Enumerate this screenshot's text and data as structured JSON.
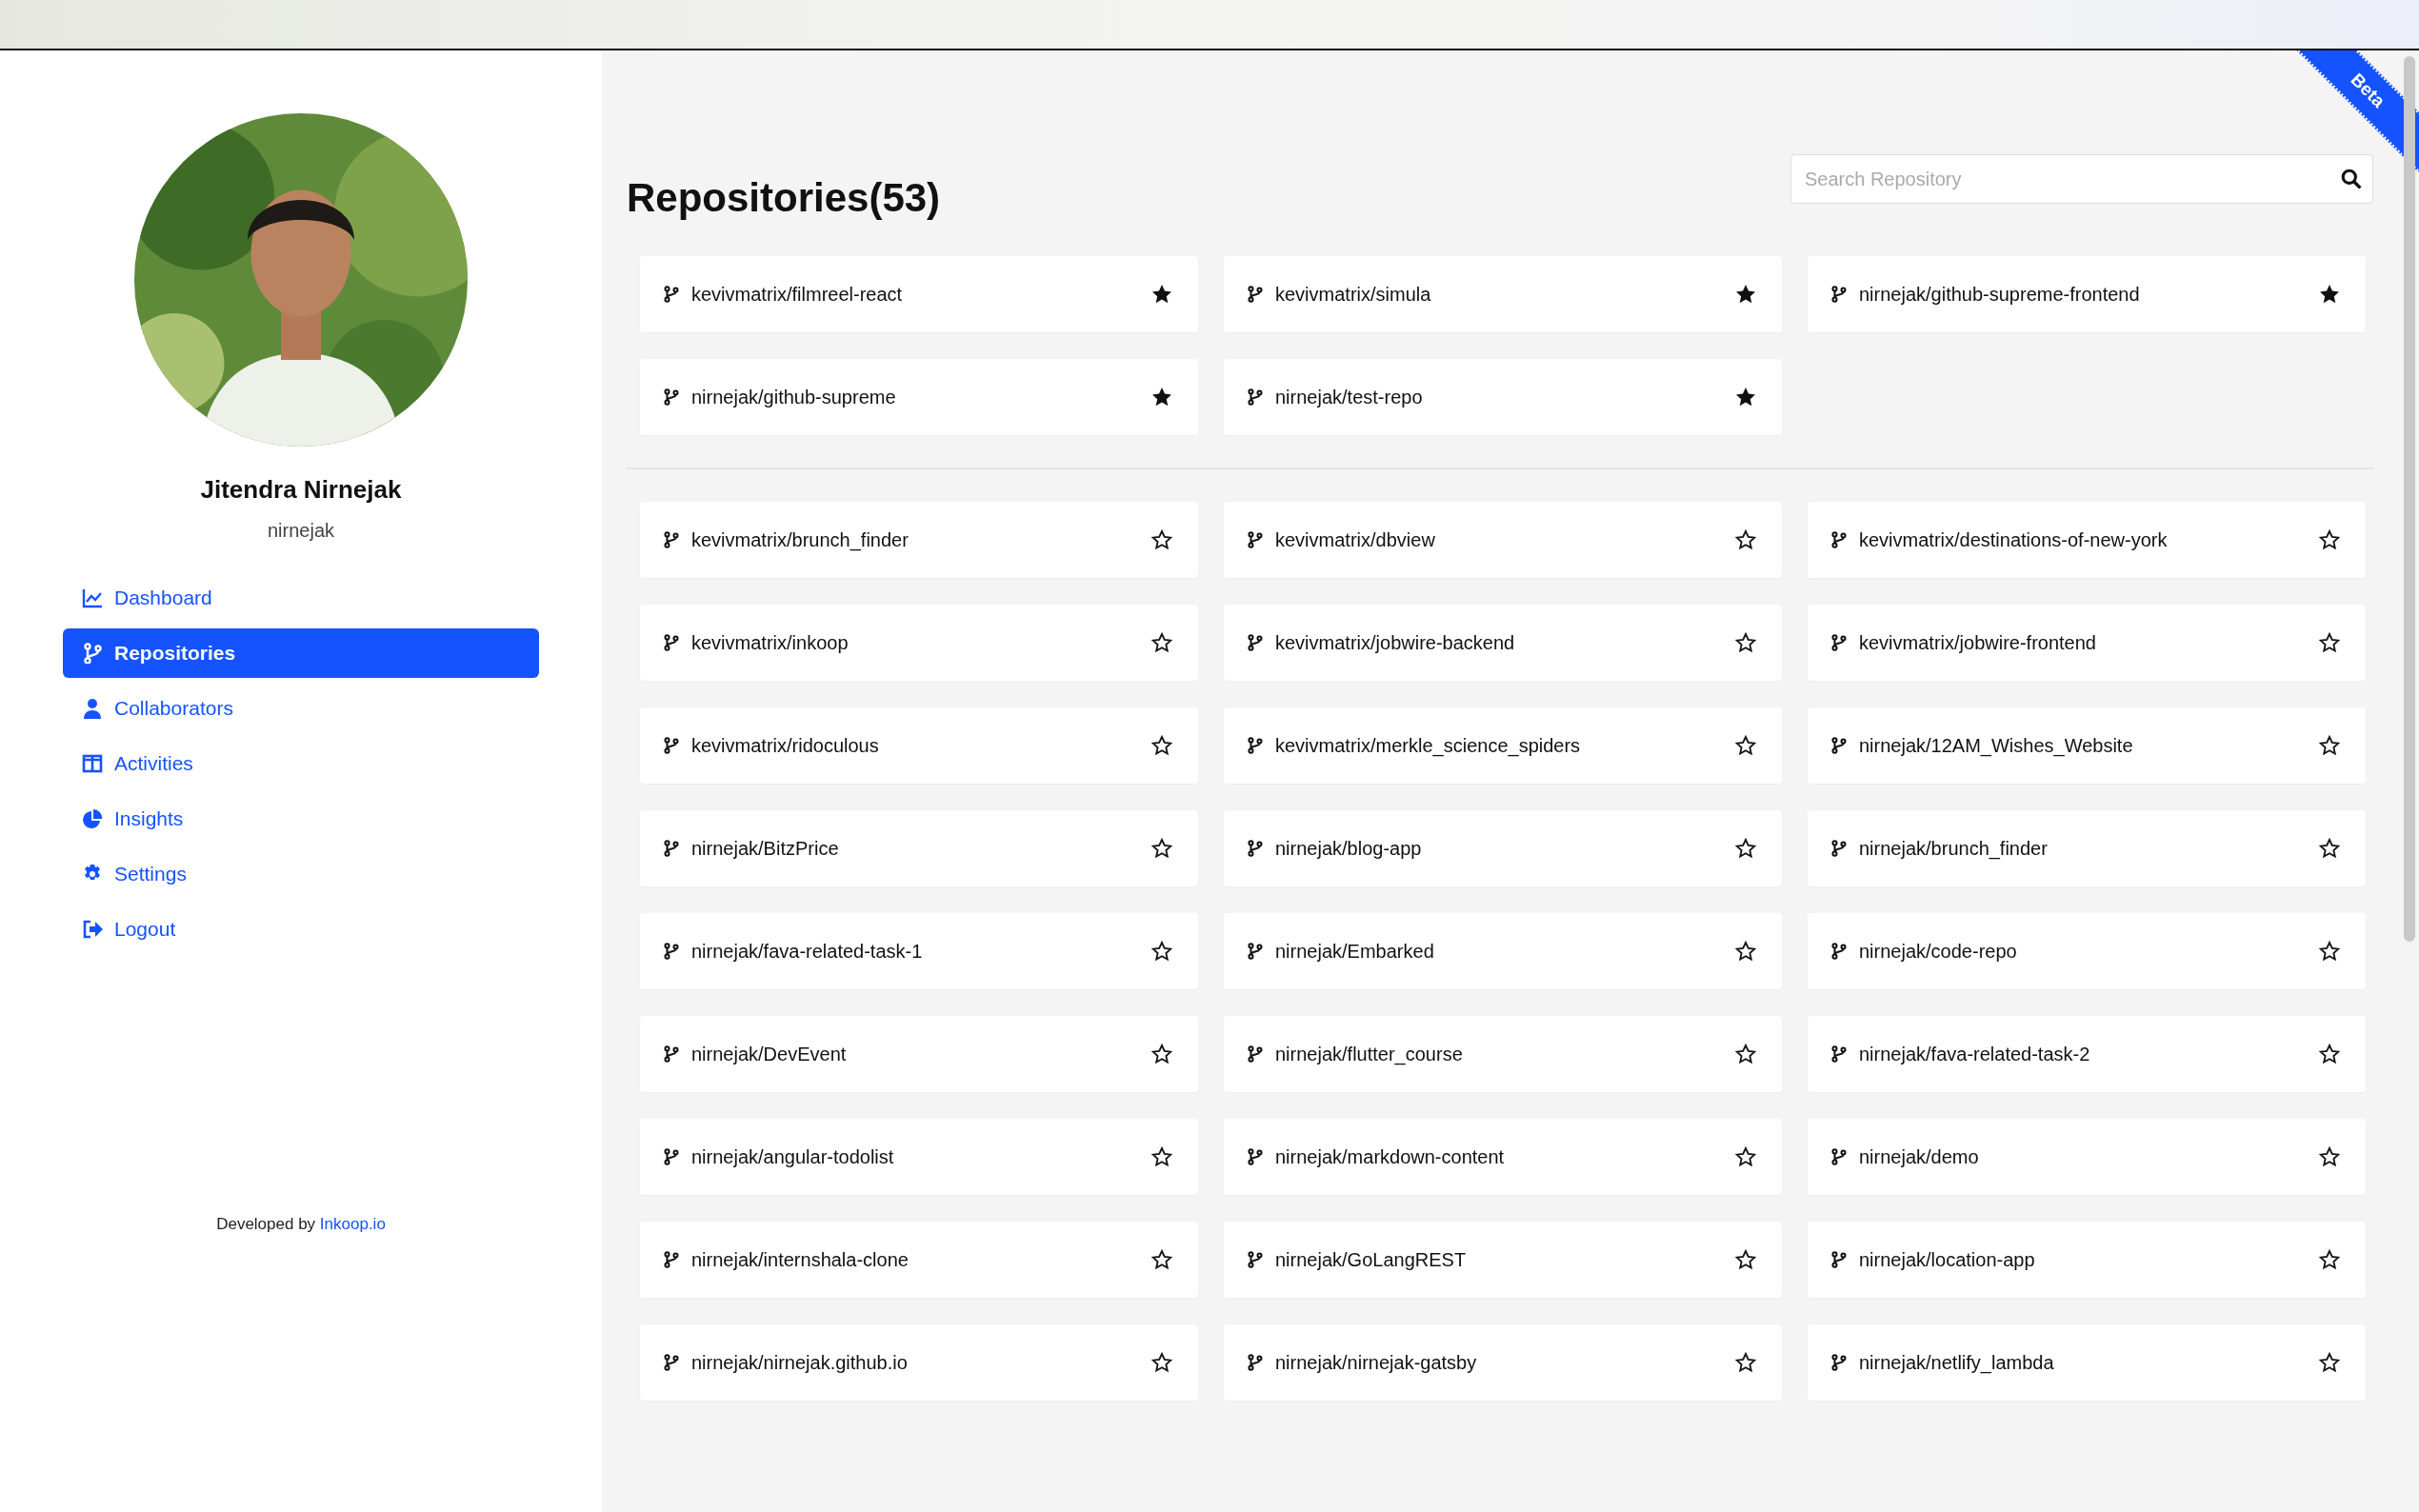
{
  "sidebar": {
    "profile": {
      "name": "Jitendra Nirnejak",
      "username": "nirnejak"
    },
    "nav": [
      {
        "label": "Dashboard",
        "selected": false
      },
      {
        "label": "Repositories",
        "selected": true
      },
      {
        "label": "Collaborators",
        "selected": false
      },
      {
        "label": "Activities",
        "selected": false
      },
      {
        "label": "Insights",
        "selected": false
      },
      {
        "label": "Settings",
        "selected": false
      },
      {
        "label": "Logout",
        "selected": false
      }
    ],
    "footer": {
      "text": "Developed by",
      "link": "Inkoop.io"
    }
  },
  "main": {
    "title": "Repositories(53)",
    "ribbon": "Beta",
    "search": {
      "placeholder": "Search Repository"
    },
    "starred_repos": [
      {
        "name": "kevivmatrix/filmreel-react",
        "starred": true
      },
      {
        "name": "kevivmatrix/simula",
        "starred": true
      },
      {
        "name": "nirnejak/github-supreme-frontend",
        "starred": true
      },
      {
        "name": "nirnejak/github-supreme",
        "starred": true
      },
      {
        "name": "nirnejak/test-repo",
        "starred": true
      }
    ],
    "repos": [
      {
        "name": "kevivmatrix/brunch_finder",
        "starred": false
      },
      {
        "name": "kevivmatrix/dbview",
        "starred": false
      },
      {
        "name": "kevivmatrix/destinations-of-new-york",
        "starred": false
      },
      {
        "name": "kevivmatrix/inkoop",
        "starred": false
      },
      {
        "name": "kevivmatrix/jobwire-backend",
        "starred": false
      },
      {
        "name": "kevivmatrix/jobwire-frontend",
        "starred": false
      },
      {
        "name": "kevivmatrix/ridoculous",
        "starred": false
      },
      {
        "name": "kevivmatrix/merkle_science_spiders",
        "starred": false
      },
      {
        "name": "nirnejak/12AM_Wishes_Website",
        "starred": false
      },
      {
        "name": "nirnejak/BitzPrice",
        "starred": false
      },
      {
        "name": "nirnejak/blog-app",
        "starred": false
      },
      {
        "name": "nirnejak/brunch_finder",
        "starred": false
      },
      {
        "name": "nirnejak/fava-related-task-1",
        "starred": false
      },
      {
        "name": "nirnejak/Embarked",
        "starred": false
      },
      {
        "name": "nirnejak/code-repo",
        "starred": false
      },
      {
        "name": "nirnejak/DevEvent",
        "starred": false
      },
      {
        "name": "nirnejak/flutter_course",
        "starred": false
      },
      {
        "name": "nirnejak/fava-related-task-2",
        "starred": false
      },
      {
        "name": "nirnejak/angular-todolist",
        "starred": false
      },
      {
        "name": "nirnejak/markdown-content",
        "starred": false
      },
      {
        "name": "nirnejak/demo",
        "starred": false
      },
      {
        "name": "nirnejak/internshala-clone",
        "starred": false
      },
      {
        "name": "nirnejak/GoLangREST",
        "starred": false
      },
      {
        "name": "nirnejak/location-app",
        "starred": false
      },
      {
        "name": "nirnejak/nirnejak.github.io",
        "starred": false
      },
      {
        "name": "nirnejak/nirnejak-gatsby",
        "starred": false
      },
      {
        "name": "nirnejak/netlify_lambda",
        "starred": false
      }
    ]
  }
}
